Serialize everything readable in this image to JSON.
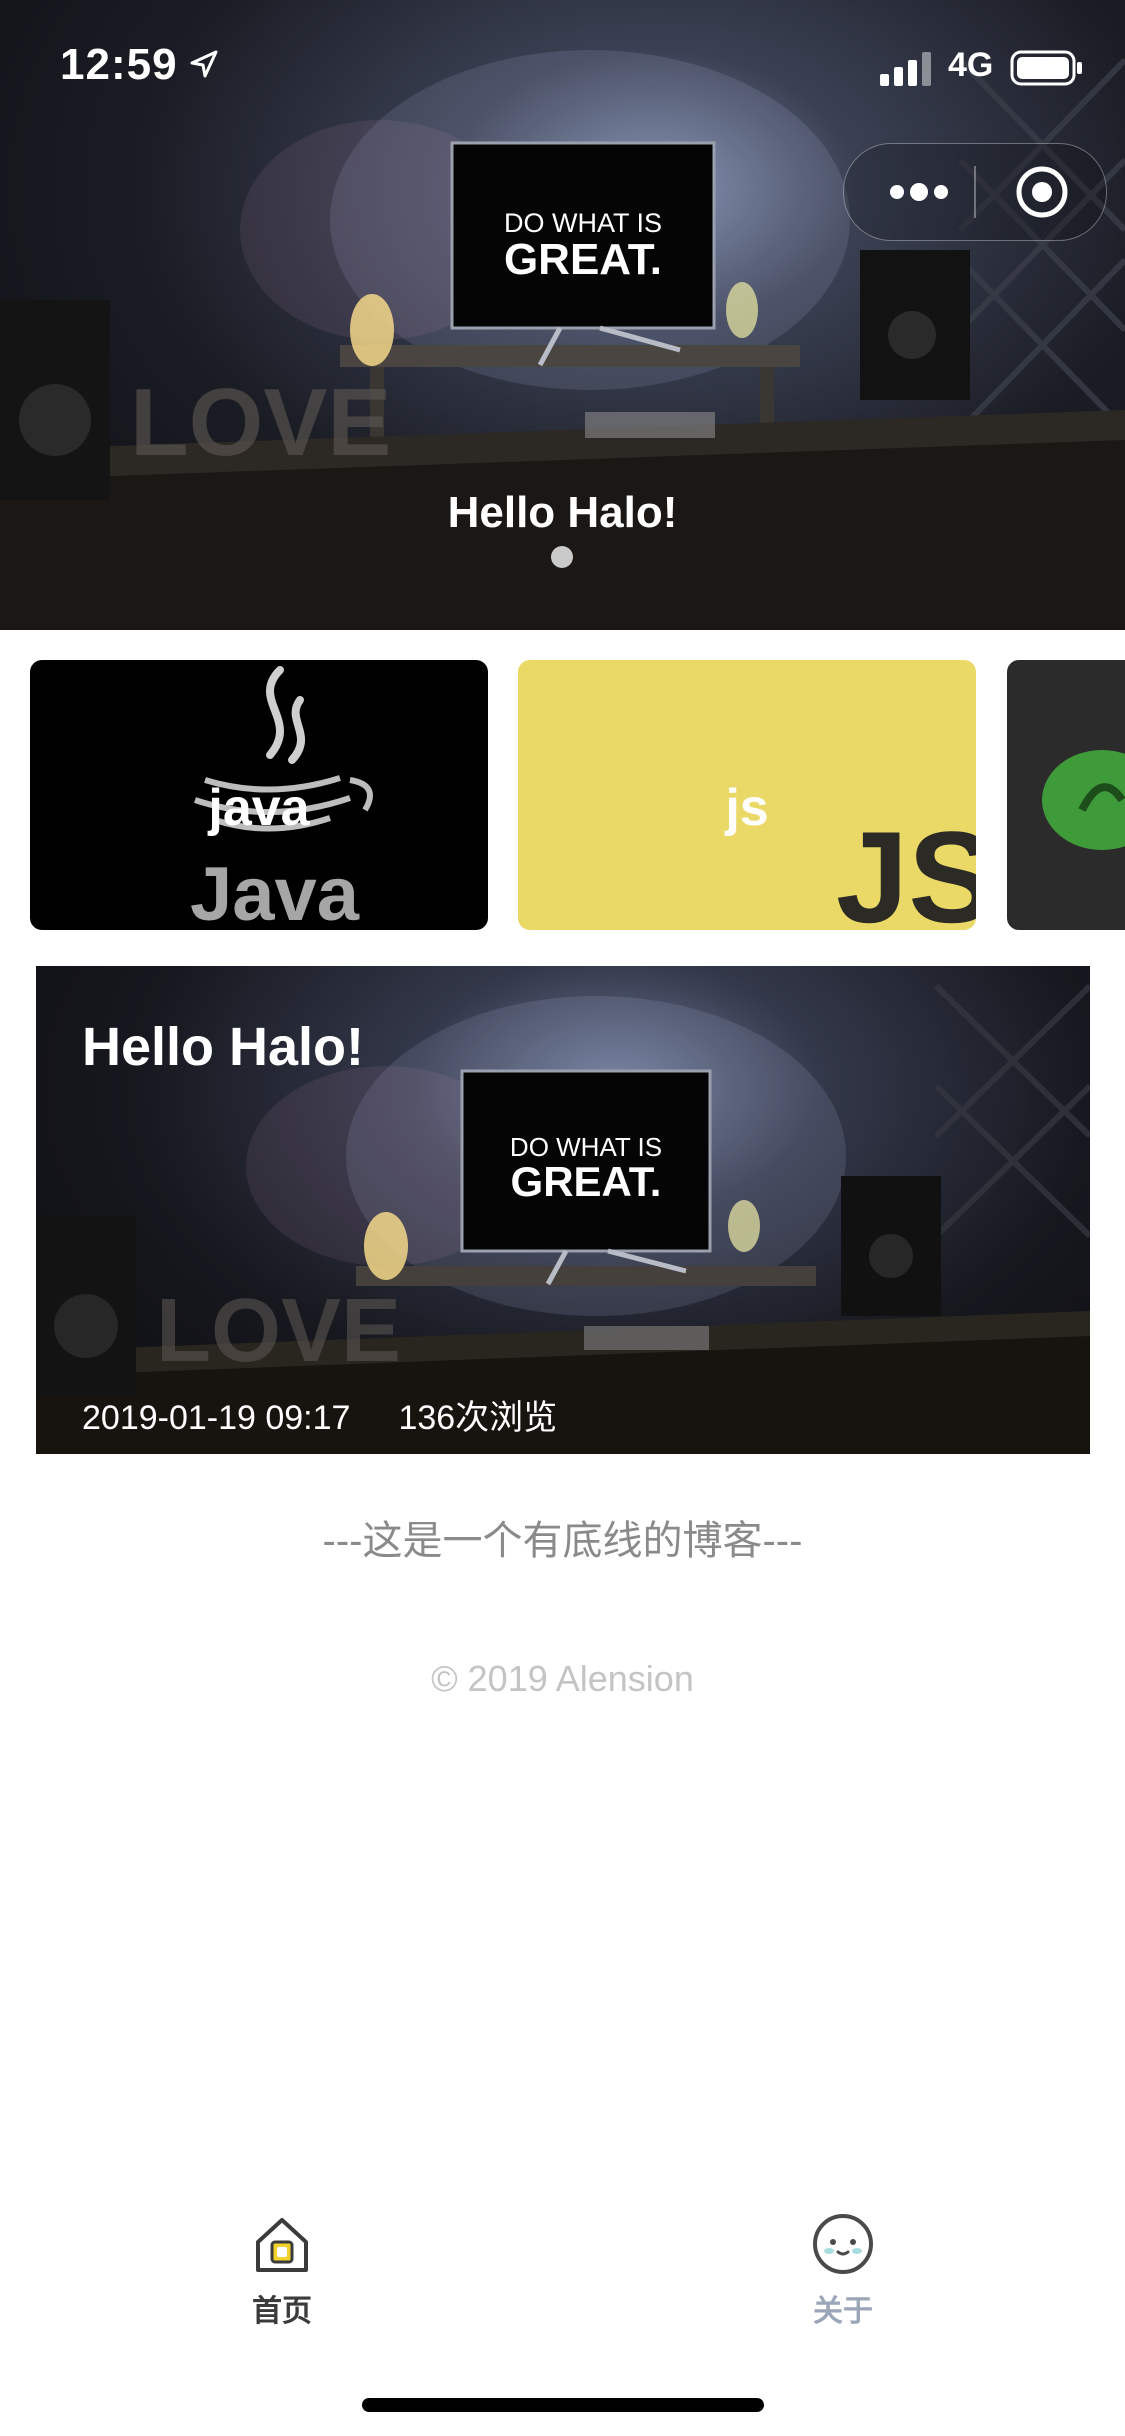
{
  "status_bar": {
    "time": "12:59",
    "network": "4G",
    "location_icon": "location-arrow-icon",
    "signal_icon": "signal-bars-icon",
    "battery_icon": "battery-icon"
  },
  "capsule": {
    "more_icon": "more-dots-icon",
    "close_icon": "target-close-icon"
  },
  "hero": {
    "title": "Hello Halo!",
    "image_text_line1": "DO WHAT IS",
    "image_text_line2": "GREAT.",
    "image_love_text": "LOVE",
    "active_slide": 1,
    "slide_count": 1
  },
  "categories": [
    {
      "label": "java",
      "art_text": "Java",
      "bg": "#000000"
    },
    {
      "label": "js",
      "art_text": "JS",
      "bg": "#ead967"
    },
    {
      "label": "",
      "art_text": "",
      "bg": "#2b2b2b"
    }
  ],
  "post": {
    "title": "Hello Halo!",
    "date": "2019-01-19 09:17",
    "views": "136次浏览",
    "image_text_line1": "DO WHAT IS",
    "image_text_line2": "GREAT.",
    "image_love_text": "LOVE"
  },
  "footer": {
    "bottom_line": "---这是一个有底线的博客---",
    "copyright": "© 2019 Alension"
  },
  "tabbar": {
    "home_label": "首页",
    "about_label": "关于",
    "active": "home",
    "home_icon": "home-icon",
    "about_icon": "smiley-face-icon"
  },
  "colors": {
    "js_yellow": "#ead967",
    "tab_active": "#3b3b3b",
    "tab_inactive": "#9aa6b8",
    "bottom_line_text": "#8a8a8a",
    "copyright_text": "#c4c4c4"
  }
}
